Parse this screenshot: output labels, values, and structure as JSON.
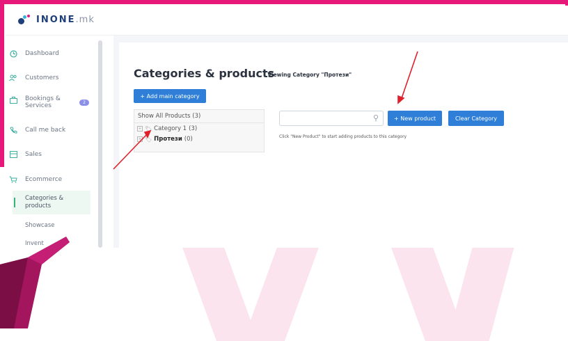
{
  "brand": {
    "name": "INONE",
    "suffix": ".mk"
  },
  "sidebar": {
    "items": [
      {
        "label": "Dashboard",
        "icon": "clock-icon"
      },
      {
        "label": "Customers",
        "icon": "users-icon"
      },
      {
        "label": "Bookings & Services",
        "line1": "Bookings &",
        "line2": "Services",
        "icon": "briefcase-icon",
        "badge": "2"
      },
      {
        "label": "Call me back",
        "icon": "phone-icon"
      },
      {
        "label": "Sales",
        "icon": "ledger-icon"
      },
      {
        "label": "Ecommerce",
        "icon": "cart-icon"
      }
    ],
    "subitems": [
      {
        "label": "Categories & products",
        "line1": "Categories &",
        "line2": "products",
        "active": true
      },
      {
        "label": "Showcase"
      },
      {
        "label": "Inventory",
        "partial": "Invent"
      }
    ]
  },
  "page": {
    "title": "Categories & products",
    "subtitle": "/ Viewing Category \"Протези\""
  },
  "buttons": {
    "add_main_category": "+ Add main category",
    "new_product": "+ New product",
    "clear_category": "Clear Category"
  },
  "tree": {
    "header": "Show All Products (3)",
    "rows": [
      {
        "name": "Category 1",
        "count": "(3)",
        "bold": false
      },
      {
        "name": "Протези",
        "count": "(0)",
        "bold": true
      }
    ]
  },
  "search": {
    "placeholder": "",
    "icon": "search-icon"
  },
  "hint": "Click \"New Product\" to start adding products to this category",
  "colors": {
    "accent": "#2f7fd8",
    "brand_pink": "#e6197a",
    "arrow_red": "#e0202a",
    "sidebar_icon": "#3ab0a0"
  }
}
